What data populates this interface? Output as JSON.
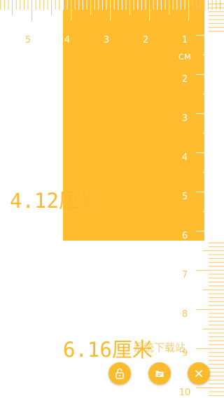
{
  "ruler": {
    "unit_label": "CM",
    "top_numbers": [
      "5",
      "4",
      "3",
      "2",
      "1"
    ],
    "side_numbers": [
      "2",
      "3",
      "4",
      "5",
      "6",
      "7",
      "8",
      "9",
      "10"
    ]
  },
  "measurements": {
    "width_label": "4.12厘米",
    "height_label": "6.16厘米"
  },
  "watermark": "系统下载站",
  "actions": {
    "lock_icon": "unlock-icon",
    "files_icon": "file-icon",
    "close_icon": "close-icon"
  },
  "colors": {
    "accent": "#FBBB2C",
    "measure_fill": "#FFBC2E",
    "label": "#F9BA2E",
    "background": "#FFFFFF"
  }
}
